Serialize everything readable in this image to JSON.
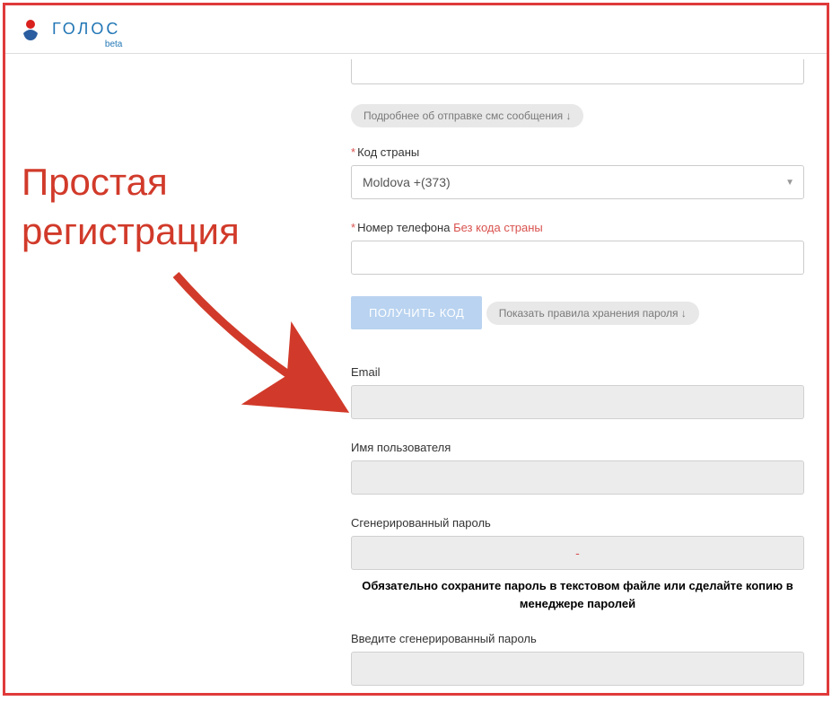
{
  "header": {
    "brand": "ГОЛОС",
    "beta": "beta"
  },
  "annotation": {
    "line1": "Простая",
    "line2": "регистрация"
  },
  "form": {
    "sms_hint": "Подробнее об отправке смс сообщения ↓",
    "country_label": "Код страны",
    "country_value": "Moldova +(373)",
    "phone_label": "Номер телефона",
    "phone_hint": "Без кода страны",
    "phone_value": "",
    "get_code_btn": "ПОЛУЧИТЬ КОД",
    "password_rules_hint": "Показать правила хранения пароля ↓",
    "email_label": "Email",
    "email_value": "",
    "username_label": "Имя пользователя",
    "username_value": "",
    "gen_password_label": "Сгенерированный пароль",
    "gen_password_value": "-",
    "password_note": "Обязательно сохраните пароль в текстовом файле или сделайте копию в менеджере паролей",
    "confirm_password_label": "Введите сгенерированный пароль",
    "confirm_password_value": ""
  }
}
